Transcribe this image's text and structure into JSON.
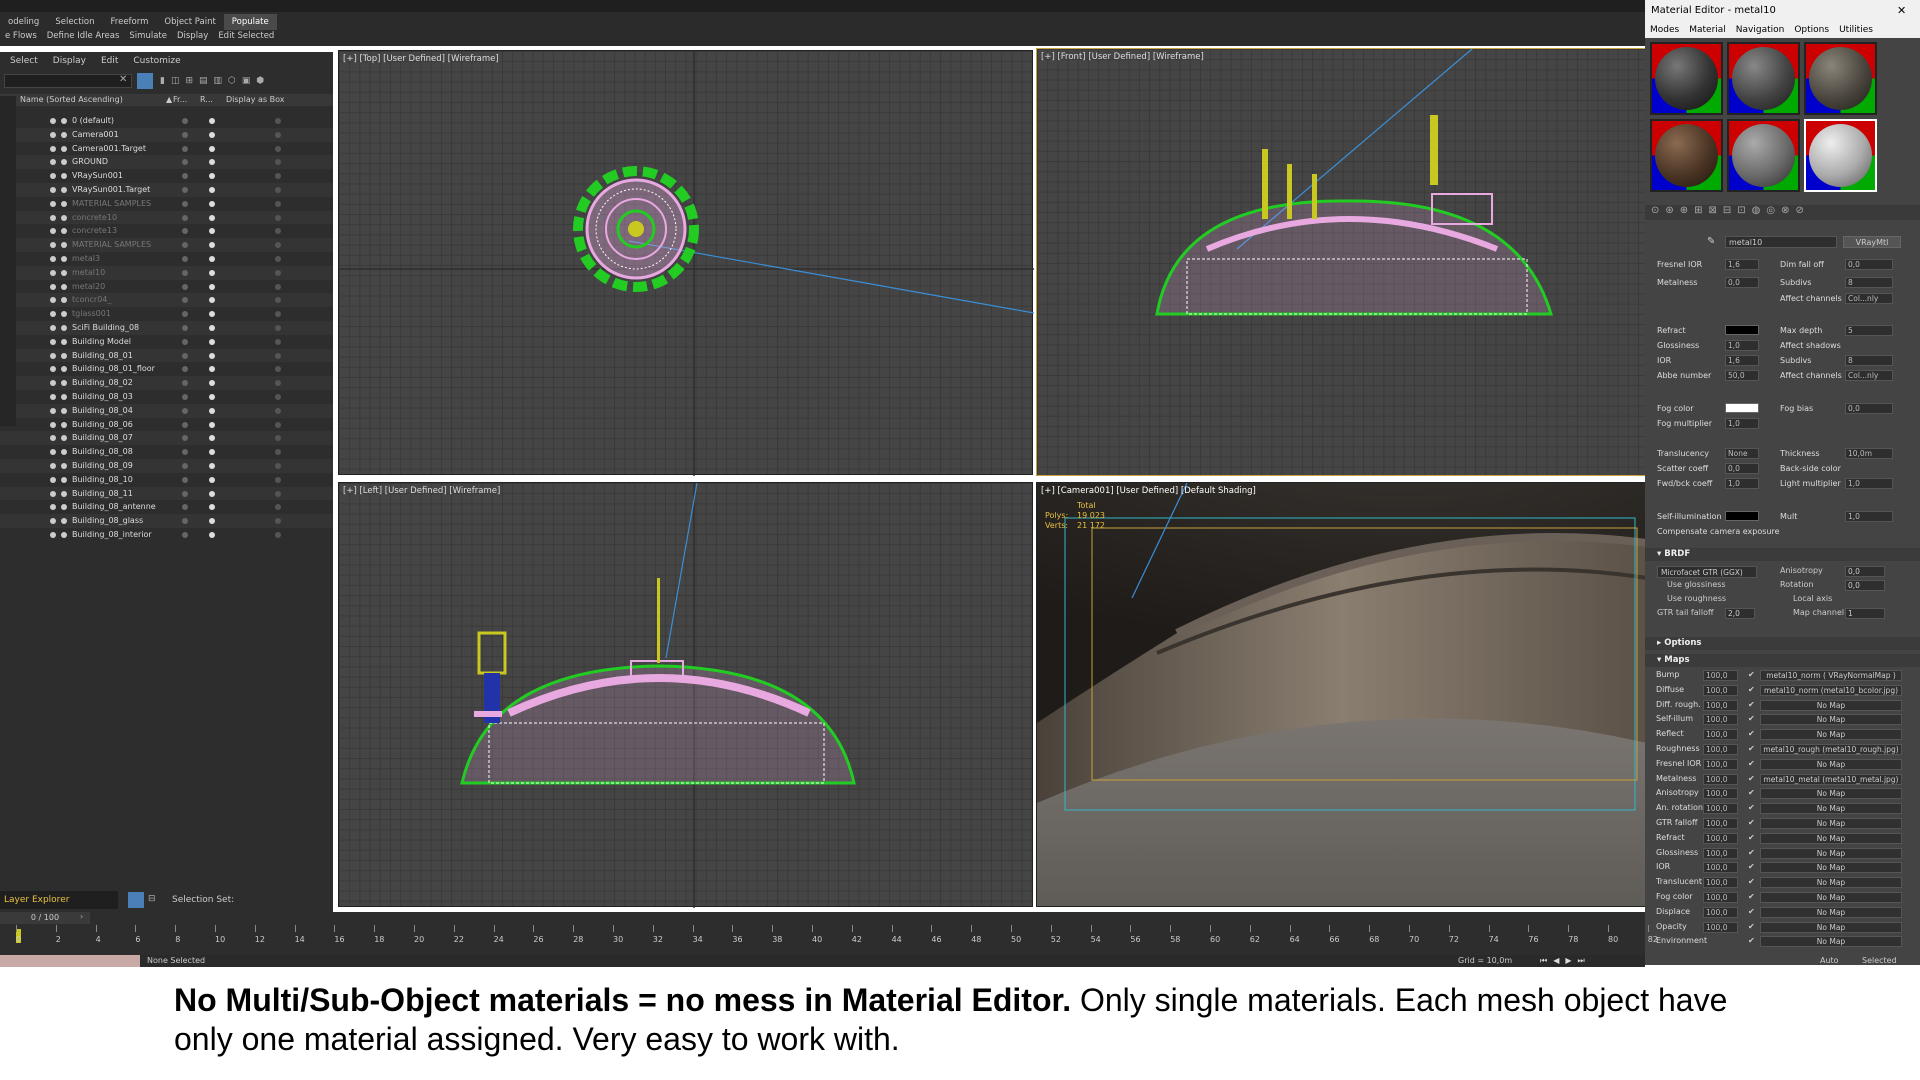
{
  "ribbon": {
    "row1": [
      "odeling",
      "Selection",
      "Freeform",
      "Object Paint",
      "Populate"
    ],
    "row2": [
      "e Flows",
      "Define Idle Areas",
      "Simulate",
      "Display",
      "Edit Selected"
    ]
  },
  "explorer": {
    "menu": [
      "Select",
      "Display",
      "Edit",
      "Customize"
    ],
    "headers": {
      "name": "Name (Sorted Ascending)",
      "fr": "Fr...",
      "r": "R...",
      "box": "Display as Box"
    },
    "rows": [
      {
        "label": "0 (default)",
        "dim": false
      },
      {
        "label": "Camera001",
        "dim": false
      },
      {
        "label": "Camera001.Target",
        "dim": false
      },
      {
        "label": "GROUND",
        "dim": false
      },
      {
        "label": "VRaySun001",
        "dim": false
      },
      {
        "label": "VRaySun001.Target",
        "dim": false
      },
      {
        "label": "MATERIAL SAMPLES",
        "dim": true
      },
      {
        "label": "concrete10",
        "dim": true
      },
      {
        "label": "concrete13",
        "dim": true
      },
      {
        "label": "MATERIAL SAMPLES",
        "dim": true
      },
      {
        "label": "metal3",
        "dim": true
      },
      {
        "label": "metal10",
        "dim": true
      },
      {
        "label": "metal20",
        "dim": true
      },
      {
        "label": "tconcr04_",
        "dim": true
      },
      {
        "label": "tglass001",
        "dim": true
      },
      {
        "label": "SciFi Building_08",
        "dim": false
      },
      {
        "label": "Building Model",
        "dim": false
      },
      {
        "label": "Building_08_01",
        "dim": false
      },
      {
        "label": "Building_08_01_floor",
        "dim": false
      },
      {
        "label": "Building_08_02",
        "dim": false
      },
      {
        "label": "Building_08_03",
        "dim": false
      },
      {
        "label": "Building_08_04",
        "dim": false
      },
      {
        "label": "Building_08_06",
        "dim": false
      },
      {
        "label": "Building_08_07",
        "dim": false
      },
      {
        "label": "Building_08_08",
        "dim": false
      },
      {
        "label": "Building_08_09",
        "dim": false
      },
      {
        "label": "Building_08_10",
        "dim": false
      },
      {
        "label": "Building_08_11",
        "dim": false
      },
      {
        "label": "Building_08_antenne",
        "dim": false
      },
      {
        "label": "Building_08_glass",
        "dim": false
      },
      {
        "label": "Building_08_interior",
        "dim": false
      }
    ],
    "footer_label": "Layer Explorer",
    "selection_set": "Selection Set:"
  },
  "viewports": {
    "top": "[+] [Top] [User Defined] [Wireframe]",
    "front": "[+] [Front] [User Defined] [Wireframe]",
    "left": "[+] [Left] [User Defined] [Wireframe]",
    "camera": "[+] [Camera001] [User Defined] [Default Shading]",
    "stats": {
      "total": "Total",
      "polys_label": "Polys:",
      "polys": "19 023",
      "verts_label": "Verts:",
      "verts": "21 172"
    }
  },
  "material_editor": {
    "title": "Material Editor - metal10",
    "menu": [
      "Modes",
      "Material",
      "Navigation",
      "Options",
      "Utilities"
    ],
    "material_name": "metal10",
    "material_type": "VRayMtl",
    "params": [
      {
        "l": "Fresnel IOR",
        "v": "1,6",
        "r": "Dim fall off",
        "rv": "0,0"
      },
      {
        "l": "Metalness",
        "v": "0,0",
        "r": "Subdivs",
        "rv": "8"
      },
      {
        "l": "",
        "v": "",
        "r": "Affect channels",
        "rv": "Col...nly"
      },
      {
        "l": "Refract",
        "v": "",
        "r": "Max depth",
        "rv": "5"
      },
      {
        "l": "Glossiness",
        "v": "1,0",
        "r": "Affect shadows",
        "rv": ""
      },
      {
        "l": "IOR",
        "v": "1,6",
        "r": "Subdivs",
        "rv": "8"
      },
      {
        "l": "Abbe number",
        "v": "50,0",
        "r": "Affect channels",
        "rv": "Col...nly"
      },
      {
        "l": "Fog color",
        "v": "",
        "r": "Fog bias",
        "rv": "0,0"
      },
      {
        "l": "Fog multiplier",
        "v": "1,0",
        "r": "",
        "rv": ""
      },
      {
        "l": "Translucency",
        "v": "None",
        "r": "Thickness",
        "rv": "10,0m"
      },
      {
        "l": "Scatter coeff",
        "v": "0,0",
        "r": "Back-side color",
        "rv": ""
      },
      {
        "l": "Fwd/bck coeff",
        "v": "1,0",
        "r": "Light multiplier",
        "rv": "1,0"
      },
      {
        "l": "Self-illumination",
        "v": "",
        "r": "Mult",
        "rv": "1,0"
      },
      {
        "l": "Compensate camera exposure",
        "v": "",
        "r": "",
        "rv": ""
      }
    ],
    "brdf": {
      "title": "BRDF",
      "type": "Microfacet GTR (GGX)",
      "use_glossiness": "Use glossiness",
      "use_roughness": "Use roughness",
      "gtr_label": "GTR tail falloff",
      "gtr": "2,0",
      "anisotropy_label": "Anisotropy",
      "anisotropy": "0,0",
      "rotation_label": "Rotation",
      "rotation": "0,0",
      "local_axis": "Local axis",
      "map_channel_label": "Map channel",
      "map_channel": "1"
    },
    "options_title": "Options",
    "maps_title": "Maps",
    "maps": [
      {
        "l": "Bump",
        "v": "100,0",
        "m": "metal10_norm ( VRayNormalMap )"
      },
      {
        "l": "Diffuse",
        "v": "100,0",
        "m": "metal10_norm (metal10_bcolor.jpg)"
      },
      {
        "l": "Diff. rough.",
        "v": "100,0",
        "m": "No Map"
      },
      {
        "l": "Self-illum",
        "v": "100,0",
        "m": "No Map"
      },
      {
        "l": "Reflect",
        "v": "100,0",
        "m": "No Map"
      },
      {
        "l": "Roughness",
        "v": "100,0",
        "m": "metal10_rough (metal10_rough.jpg)"
      },
      {
        "l": "Fresnel IOR",
        "v": "100,0",
        "m": "No Map"
      },
      {
        "l": "Metalness",
        "v": "100,0",
        "m": "metal10_metal (metal10_metal.jpg)"
      },
      {
        "l": "Anisotropy",
        "v": "100,0",
        "m": "No Map"
      },
      {
        "l": "An. rotation",
        "v": "100,0",
        "m": "No Map"
      },
      {
        "l": "GTR falloff",
        "v": "100,0",
        "m": "No Map"
      },
      {
        "l": "Refract",
        "v": "100,0",
        "m": "No Map"
      },
      {
        "l": "Glossiness",
        "v": "100,0",
        "m": "No Map"
      },
      {
        "l": "IOR",
        "v": "100,0",
        "m": "No Map"
      },
      {
        "l": "Translucent",
        "v": "100,0",
        "m": "No Map"
      },
      {
        "l": "Fog color",
        "v": "100,0",
        "m": "No Map"
      },
      {
        "l": "Displace",
        "v": "100,0",
        "m": "No Map"
      },
      {
        "l": "Opacity",
        "v": "100,0",
        "m": "No Map"
      },
      {
        "l": "Environment",
        "v": "",
        "m": "No Map"
      }
    ]
  },
  "timeline": {
    "frame_counter": "0 / 100",
    "ticks": [
      "0",
      "2",
      "4",
      "6",
      "8",
      "10",
      "12",
      "14",
      "16",
      "18",
      "20",
      "22",
      "24",
      "26",
      "28",
      "30",
      "32",
      "34",
      "36",
      "38",
      "40",
      "42",
      "44",
      "46",
      "48",
      "50",
      "52",
      "54",
      "56",
      "58",
      "60",
      "62",
      "64",
      "66",
      "68",
      "70",
      "72",
      "74",
      "76",
      "78",
      "80",
      "82"
    ]
  },
  "status": {
    "selection": "None Selected",
    "grid": "Grid = 10,0m",
    "auto_key": "Auto Key",
    "selected": "Selected"
  },
  "caption": {
    "bold": "No Multi/Sub-Object materials = no mess in Material Editor.",
    "rest": " Only single materials. Each mesh object have only one material assigned. Very easy to work with."
  },
  "colors": {
    "accent": "#c8a23a",
    "wire_green": "#22cc22",
    "wire_pink": "#e8a8e0"
  }
}
